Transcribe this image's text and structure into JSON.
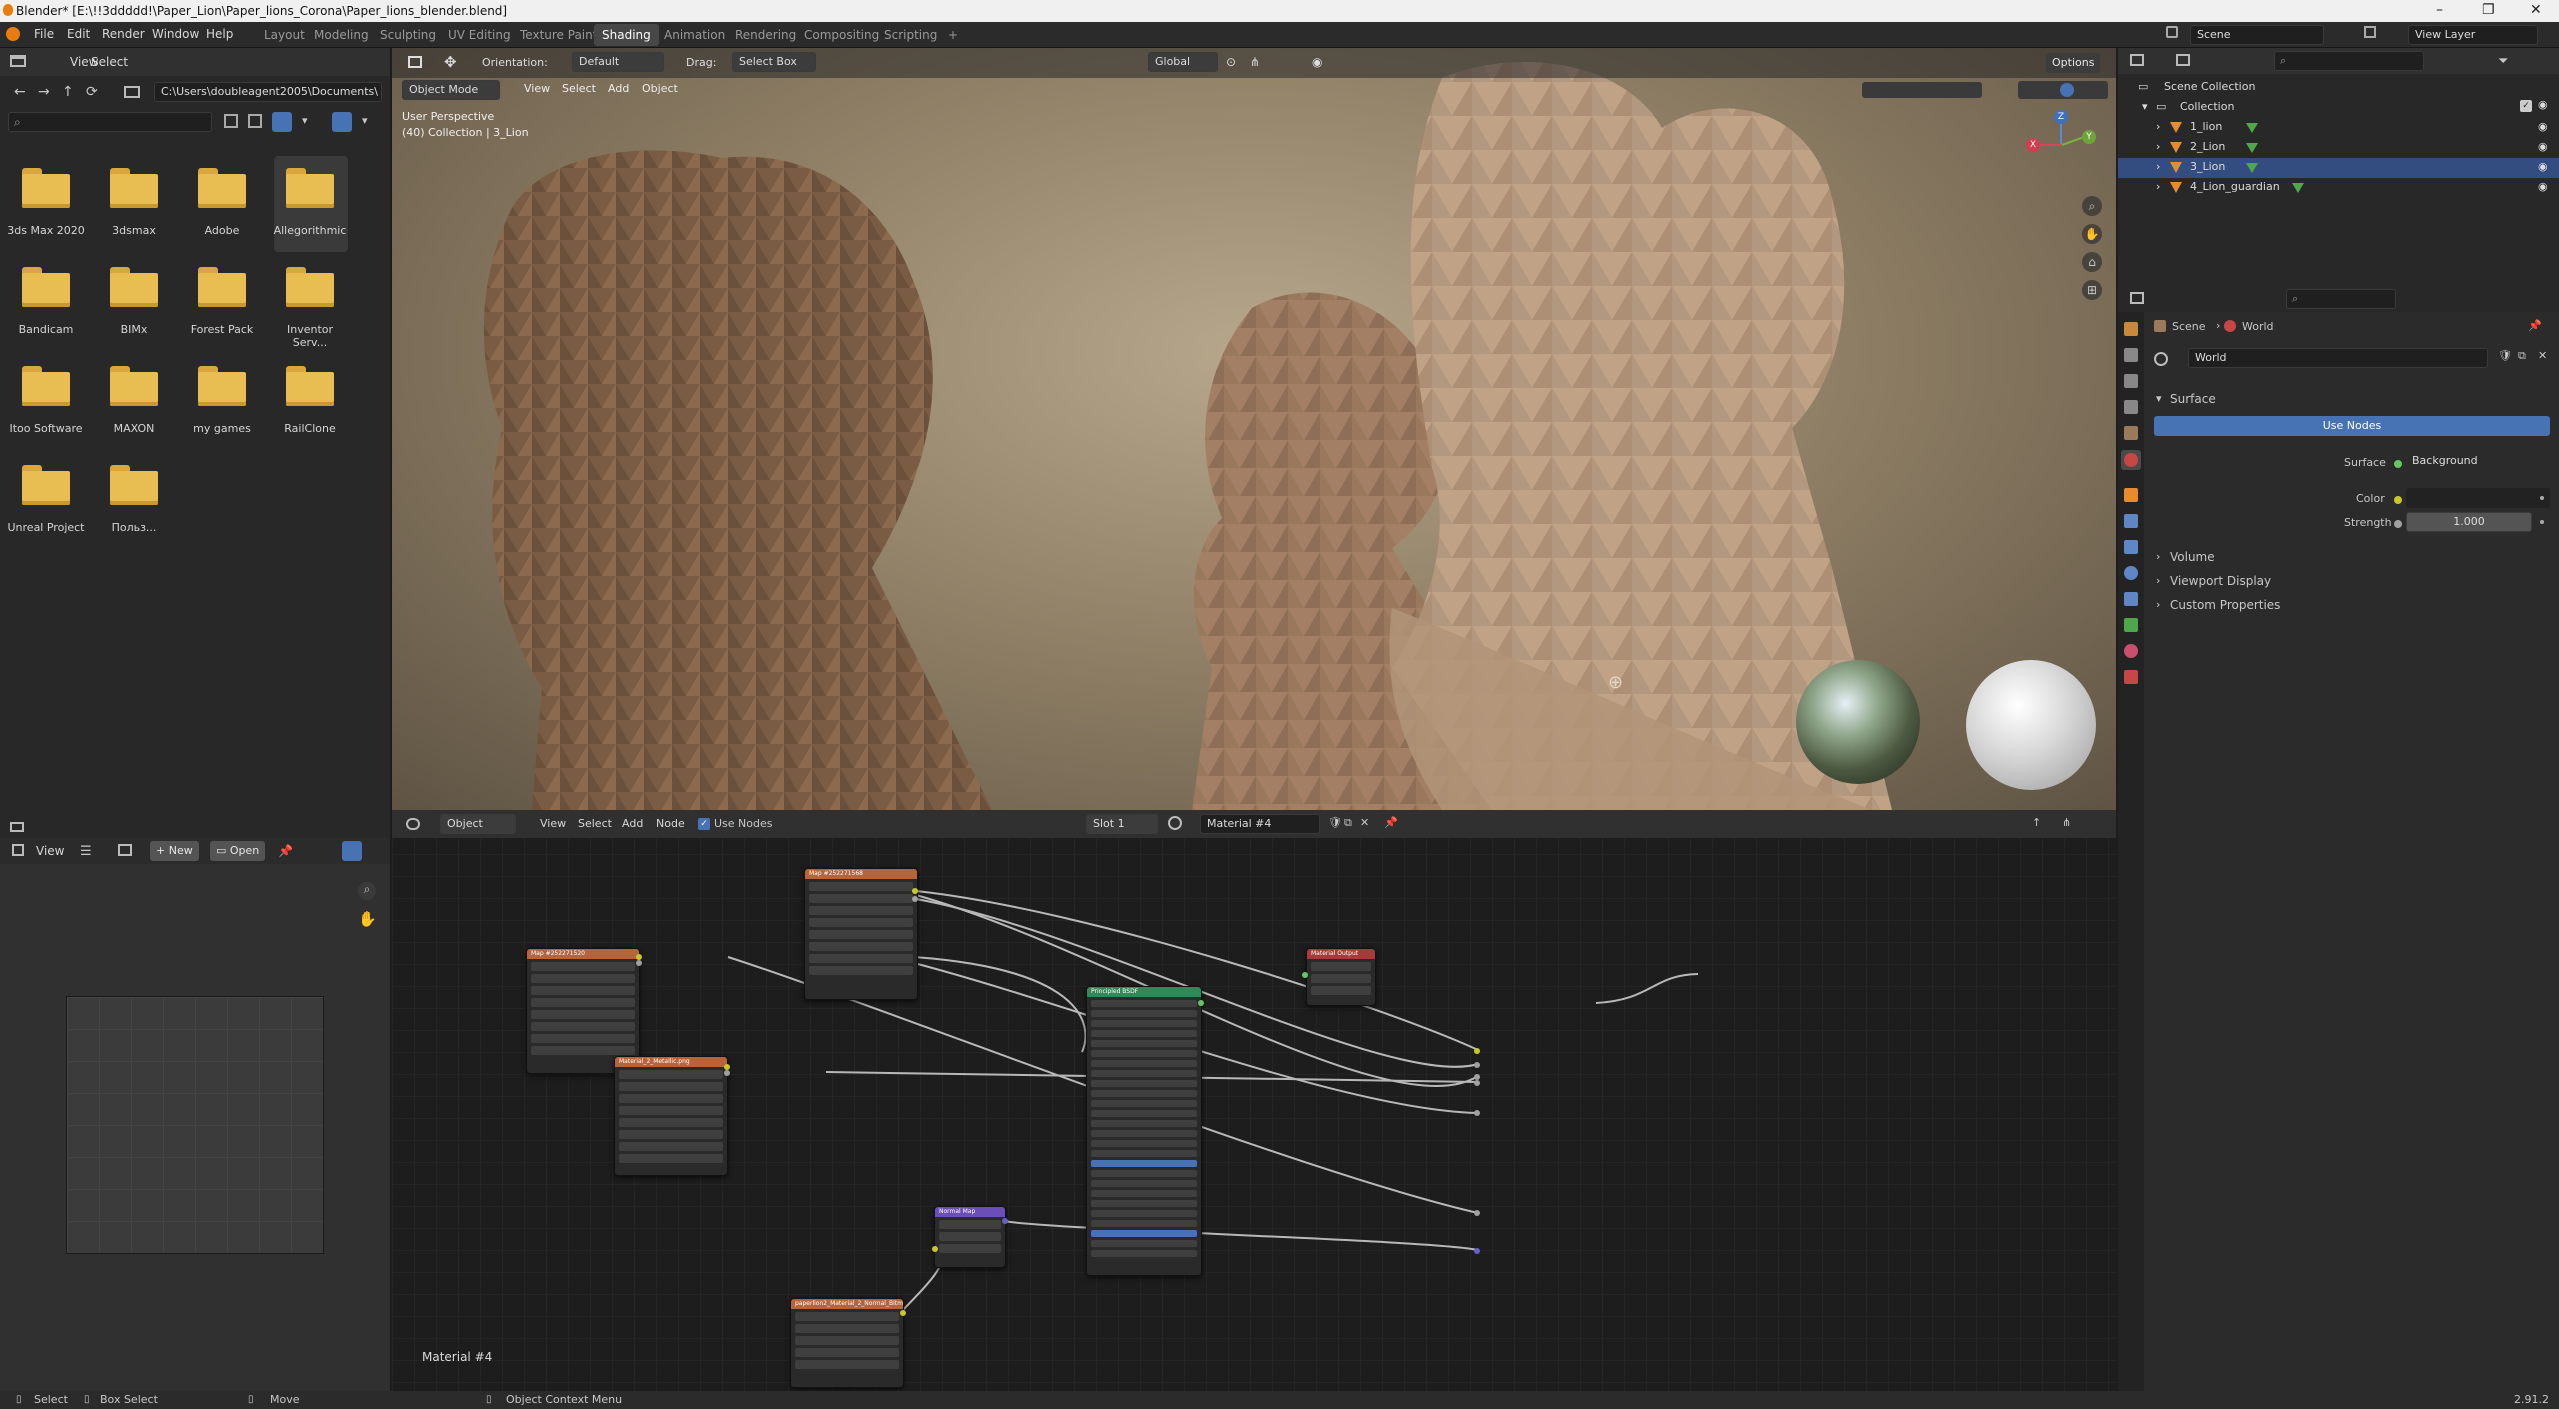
{
  "window": {
    "title": "Blender* [E:\\!!3ddddd!\\Paper_Lion\\Paper_lions_Corona\\Paper_lions_blender.blend]",
    "min": "–",
    "max": "❐",
    "close": "✕"
  },
  "menubar": {
    "items": [
      "File",
      "Edit",
      "Render",
      "Window",
      "Help"
    ]
  },
  "workspaces": [
    {
      "label": "Layout"
    },
    {
      "label": "Modeling"
    },
    {
      "label": "Sculpting"
    },
    {
      "label": "UV Editing"
    },
    {
      "label": "Texture Paint"
    },
    {
      "label": "Shading"
    },
    {
      "label": "Animation"
    },
    {
      "label": "Rendering"
    },
    {
      "label": "Compositing"
    },
    {
      "label": "Scripting"
    }
  ],
  "workspace_add": "+",
  "scene_field": "Scene",
  "viewlayer_field": "View Layer",
  "filebrowser": {
    "menu": [
      "View",
      "Select"
    ],
    "path": "C:\\Users\\doubleagent2005\\Documents\\",
    "folders": [
      "3ds Max 2020",
      "3dsmax",
      "Adobe",
      "Allegorithmic",
      "Bandicam",
      "BIMx",
      "Forest Pack",
      "Inventor Serv...",
      "Itoo Software",
      "MAXON",
      "my games",
      "RailClone",
      "Unreal Project",
      "Польз..."
    ]
  },
  "viewport": {
    "mode": "Object Mode",
    "menus": [
      "View",
      "Select",
      "Add",
      "Object"
    ],
    "orientation_label": "Orientation:",
    "orientation_value": "Default",
    "drag_label": "Drag:",
    "drag_value": "Select Box",
    "transform": "Global",
    "options": "Options",
    "info_line1": "User Perspective",
    "info_line2": "(40) Collection | 3_Lion",
    "gizmo": {
      "x": "X",
      "y": "Y",
      "z": "Z"
    }
  },
  "image_editor": {
    "view": "View",
    "new": "New",
    "open": "Open"
  },
  "node_editor": {
    "object": "Object",
    "menus": [
      "View",
      "Select",
      "Add",
      "Node"
    ],
    "use_nodes": "Use Nodes",
    "slot": "Slot 1",
    "material": "Material #4",
    "footer_label": "Material #4",
    "nodes": {
      "tex1": "Map #252271568",
      "tex2": "Map #252271520",
      "tex3": "Material_2_Metallic.png",
      "bsdf": "Principled BSDF",
      "output": "Material Output",
      "normalmap": "Normal Map",
      "tex4": "paperlion2_Material_2_Normal_Bitmap"
    },
    "colors": {
      "tex": "#b8643a",
      "bsdf": "#2f8a57",
      "output": "#a83a3a",
      "normal": "#6b4fb8"
    }
  },
  "outliner": {
    "root": "Scene Collection",
    "collection": "Collection",
    "items": [
      "1_lion",
      "2_Lion",
      "3_Lion",
      "4_Lion_guardian"
    ]
  },
  "properties": {
    "crumbs": [
      "Scene",
      "World"
    ],
    "world_name": "World",
    "panel_surface": "Surface",
    "use_nodes_btn": "Use Nodes",
    "surface_label": "Surface",
    "surface_value": "Background",
    "color_label": "Color",
    "strength_label": "Strength",
    "strength_value": "1.000",
    "panels": [
      "Volume",
      "Viewport Display",
      "Custom Properties"
    ]
  },
  "statusbar": {
    "select": "Select",
    "box_select": "Box Select",
    "move": "Move",
    "context_menu": "Object Context Menu",
    "version": "2.91.2"
  },
  "accent": "#4772b3"
}
